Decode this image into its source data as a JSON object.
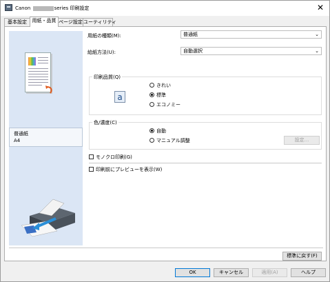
{
  "window": {
    "title_prefix": "Canon",
    "title_suffix": "series 印刷設定",
    "close_glyph": "✕"
  },
  "tabs": [
    {
      "label": "基本設定"
    },
    {
      "label": "用紙・品質"
    },
    {
      "label": "ページ設定"
    },
    {
      "label": "ユーティリティ"
    }
  ],
  "left_panel": {
    "paper_name": "普通紙",
    "paper_size": "A4"
  },
  "media_type": {
    "label": "用紙の種類(M):",
    "value": "普通紙"
  },
  "paper_source": {
    "label": "給紙方法(U):",
    "value": "自動選択"
  },
  "print_quality": {
    "title": "印刷品質(Q)",
    "icon_letter": "a",
    "options": [
      {
        "label": "きれい",
        "selected": false
      },
      {
        "label": "標準",
        "selected": true
      },
      {
        "label": "エコノミー",
        "selected": false
      }
    ]
  },
  "color_intensity": {
    "title": "色/濃度(C)",
    "options": [
      {
        "label": "自動",
        "selected": true
      },
      {
        "label": "マニュアル調整",
        "selected": false
      }
    ],
    "set_button": "設定..."
  },
  "grayscale": {
    "label": "モノクロ印刷(G)",
    "checked": false
  },
  "preview": {
    "label": "印刷前にプレビューを表示(W)",
    "checked": false
  },
  "defaults_button": "標準に戻す(F)",
  "footer": {
    "ok": "OK",
    "cancel": "キャンセル",
    "apply": "適用(A)",
    "help": "ヘルプ"
  },
  "icons": {
    "dropdown_arrow": "⌄"
  }
}
